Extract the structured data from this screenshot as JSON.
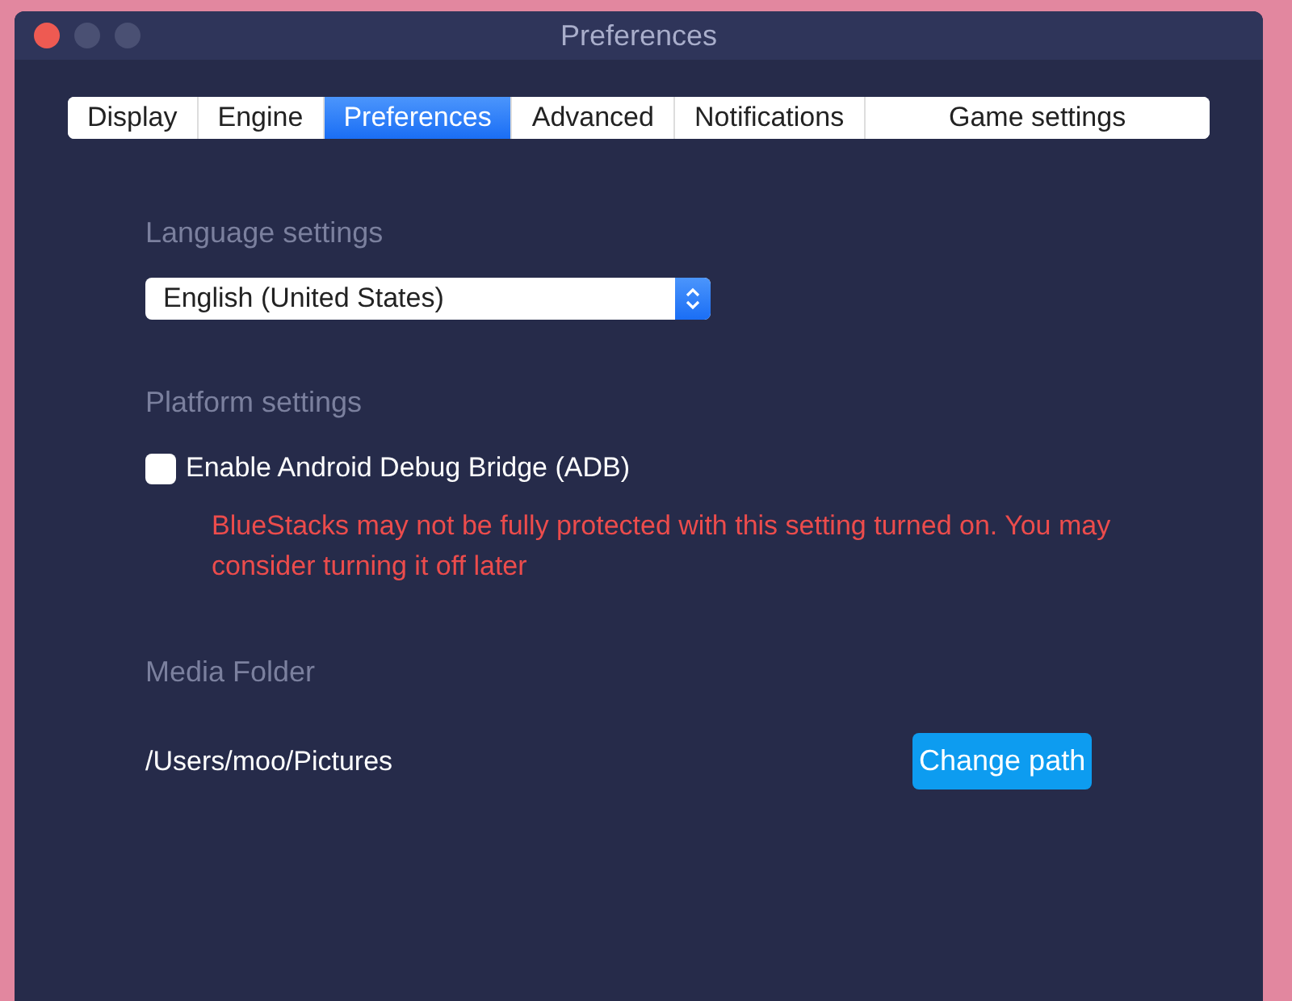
{
  "window": {
    "title": "Preferences"
  },
  "tabs": [
    {
      "label": "Display",
      "selected": false
    },
    {
      "label": "Engine",
      "selected": false
    },
    {
      "label": "Preferences",
      "selected": true
    },
    {
      "label": "Advanced",
      "selected": false
    },
    {
      "label": "Notifications",
      "selected": false
    },
    {
      "label": "Game settings",
      "selected": false
    }
  ],
  "language": {
    "heading": "Language settings",
    "value": "English (United States)"
  },
  "platform": {
    "heading": "Platform settings",
    "adb": {
      "label": "Enable Android Debug Bridge (ADB)",
      "checked": false
    },
    "warning": "BlueStacks may not be fully protected with this setting turned on. You may consider turning it off later"
  },
  "media": {
    "heading": "Media Folder",
    "path": "/Users/moo/Pictures",
    "button": "Change path"
  }
}
